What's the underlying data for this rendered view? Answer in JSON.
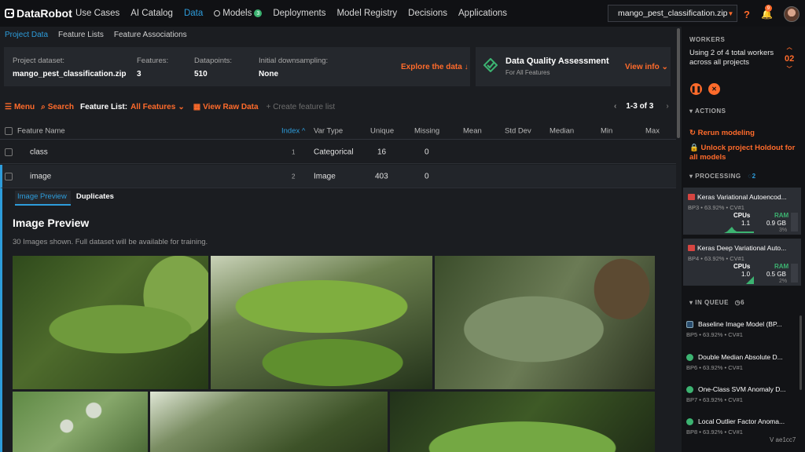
{
  "app": {
    "logo": "DataRobot"
  },
  "nav": {
    "items": [
      "Use Cases",
      "AI Catalog",
      "Data",
      "Models",
      "Deployments",
      "Model Registry",
      "Decisions",
      "Applications"
    ],
    "models_badge": "3",
    "notification_count": "9"
  },
  "project": {
    "name": "mango_pest_classification.zip"
  },
  "subtabs": [
    "Project Data",
    "Feature Lists",
    "Feature Associations"
  ],
  "summary": {
    "dataset_label": "Project dataset:",
    "dataset_value": "mango_pest_classification.zip",
    "features_label": "Features:",
    "features_value": "3",
    "datapoints_label": "Datapoints:",
    "datapoints_value": "510",
    "downsampling_label": "Initial downsampling:",
    "downsampling_value": "None",
    "explore_label": "Explore the data"
  },
  "quality": {
    "title": "Data Quality Assessment",
    "subtitle": "For All Features",
    "view_info": "View info"
  },
  "toolbar": {
    "menu": "Menu",
    "search": "Search",
    "feature_list_label": "Feature List:",
    "feature_list_value": "All Features",
    "view_raw": "View Raw Data",
    "create_list": "Create feature list",
    "pager": "1-3 of 3"
  },
  "table": {
    "headers": [
      "Feature Name",
      "Index",
      "Var Type",
      "Unique",
      "Missing",
      "Mean",
      "Std Dev",
      "Median",
      "Min",
      "Max"
    ],
    "rows": [
      {
        "name": "class",
        "index": "1",
        "type": "Categorical",
        "unique": "16",
        "missing": "0"
      },
      {
        "name": "image",
        "index": "2",
        "type": "Image",
        "unique": "403",
        "missing": "0"
      }
    ]
  },
  "preview": {
    "tabs": [
      "Image Preview",
      "Duplicates"
    ],
    "title": "Image Preview",
    "subtitle": "30 Images shown. Full dataset will be available for training."
  },
  "workers": {
    "heading": "WORKERS",
    "text": "Using 2 of 4 total workers across all projects",
    "count": "02"
  },
  "actions": {
    "heading": "ACTIONS",
    "rerun": "Rerun modeling",
    "unlock": "Unlock project Holdout for all models"
  },
  "processing": {
    "heading": "PROCESSING",
    "count": "2",
    "jobs": [
      {
        "title": "Keras Variational Autoencod...",
        "meta": "BP3 • 63.92% • CV#1",
        "cpus_label": "CPUs",
        "cpus": "1.1",
        "ram_label": "RAM",
        "ram": "0.9 GB",
        "ram_pct": "3%"
      },
      {
        "title": "Keras Deep Variational Auto...",
        "meta": "BP4 • 63.92% • CV#1",
        "cpus_label": "CPUs",
        "cpus": "1.0",
        "ram_label": "RAM",
        "ram": "0.5 GB",
        "ram_pct": "2%"
      }
    ]
  },
  "queue": {
    "heading": "IN QUEUE",
    "count": "6",
    "items": [
      {
        "title": "Baseline Image Model (BP...",
        "meta": "BP5 • 63.92% • CV#1"
      },
      {
        "title": "Double Median Absolute D...",
        "meta": "BP6 • 63.92% • CV#1"
      },
      {
        "title": "One-Class SVM Anomaly D...",
        "meta": "BP7 • 63.92% • CV#1"
      },
      {
        "title": "Local Outlier Factor Anoma...",
        "meta": "BP8 • 63.92% • CV#1"
      }
    ]
  },
  "version": "V ae1cc7",
  "colors": {
    "accent": "#ff6b2b",
    "link": "#2d9cdb",
    "success": "#3cb371"
  }
}
